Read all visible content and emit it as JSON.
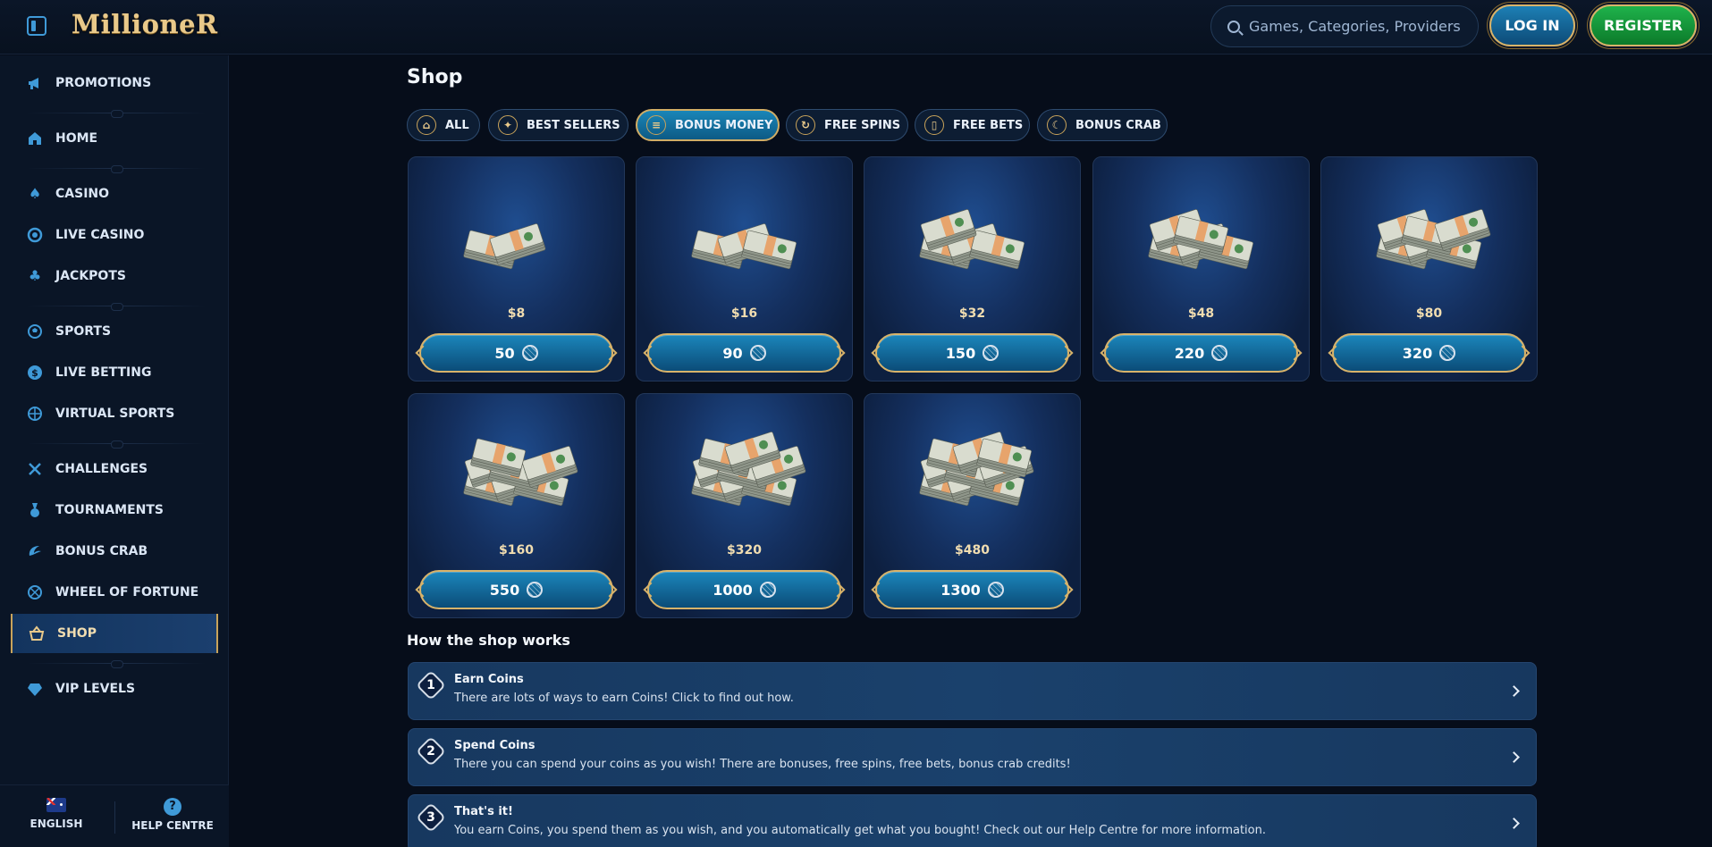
{
  "header": {
    "logo": "MillioneR",
    "search_placeholder": "Games, Categories, Providers",
    "login_label": "LOG IN",
    "register_label": "REGISTER"
  },
  "sidebar": {
    "items": [
      {
        "label": "PROMOTIONS",
        "icon": "megaphone-icon"
      },
      {
        "label": "HOME",
        "icon": "home-icon"
      },
      {
        "label": "CASINO",
        "icon": "spade-icon"
      },
      {
        "label": "LIVE CASINO",
        "icon": "chip-icon"
      },
      {
        "label": "JACKPOTS",
        "icon": "clover-icon"
      },
      {
        "label": "SPORTS",
        "icon": "soccer-ball-icon"
      },
      {
        "label": "LIVE BETTING",
        "icon": "dollar-coin-icon"
      },
      {
        "label": "VIRTUAL SPORTS",
        "icon": "globe-icon"
      },
      {
        "label": "CHALLENGES",
        "icon": "crossed-swords-icon"
      },
      {
        "label": "TOURNAMENTS",
        "icon": "medal-icon"
      },
      {
        "label": "BONUS CRAB",
        "icon": "claw-icon"
      },
      {
        "label": "WHEEL OF FORTUNE",
        "icon": "wheel-icon"
      },
      {
        "label": "SHOP",
        "icon": "basket-icon",
        "active": true
      },
      {
        "label": "VIP LEVELS",
        "icon": "diamond-icon"
      }
    ],
    "footer": {
      "language_label": "ENGLISH",
      "help_label": "HELP CENTRE"
    }
  },
  "main": {
    "title": "Shop",
    "tabs": [
      {
        "label": "ALL",
        "icon": "basket-icon"
      },
      {
        "label": "BEST SELLERS",
        "icon": "badge-icon"
      },
      {
        "label": "BONUS MONEY",
        "icon": "coin-stack-icon",
        "active": true
      },
      {
        "label": "FREE SPINS",
        "icon": "spin-icon"
      },
      {
        "label": "FREE BETS",
        "icon": "ticket-icon"
      },
      {
        "label": "BONUS CRAB",
        "icon": "claw-icon"
      }
    ],
    "products": [
      {
        "price": "$8",
        "cost": "50"
      },
      {
        "price": "$16",
        "cost": "90"
      },
      {
        "price": "$32",
        "cost": "150"
      },
      {
        "price": "$48",
        "cost": "220"
      },
      {
        "price": "$80",
        "cost": "320"
      },
      {
        "price": "$160",
        "cost": "550"
      },
      {
        "price": "$320",
        "cost": "1000"
      },
      {
        "price": "$480",
        "cost": "1300"
      }
    ],
    "how": {
      "title": "How the shop works",
      "steps": [
        {
          "num": "1",
          "title": "Earn Coins",
          "desc": "There are lots of ways to earn Coins! Click to find out how."
        },
        {
          "num": "2",
          "title": "Spend Coins",
          "desc": "There you can spend your coins as you wish! There are bonuses, free spins, free bets, bonus crab credits!"
        },
        {
          "num": "3",
          "title": "That's it!",
          "desc": "You earn Coins, you spend them as you wish, and you automatically get what you bought! Check out our Help Centre for more information."
        }
      ]
    }
  },
  "colors": {
    "accent_blue": "#3f9ad8",
    "gold": "#d8b36a",
    "register_green": "#1fb24b",
    "background": "#060d1a"
  }
}
